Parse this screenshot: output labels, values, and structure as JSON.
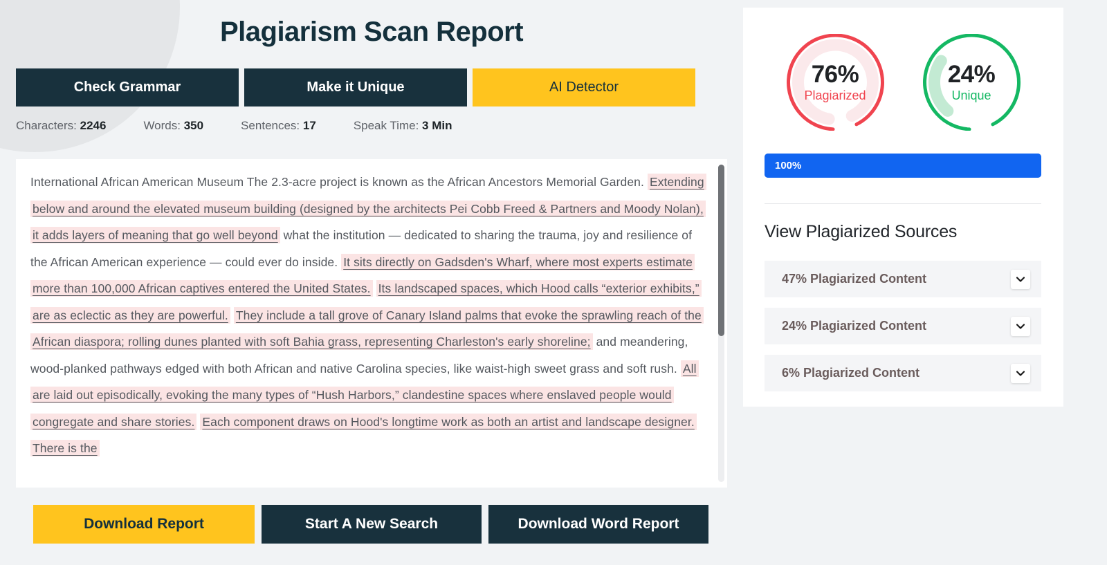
{
  "page": {
    "title": "Plagiarism Scan Report",
    "background_color": "#f1f3f5"
  },
  "tabs": [
    {
      "label": "Check Grammar",
      "style": "dark"
    },
    {
      "label": "Make it Unique",
      "style": "dark"
    },
    {
      "label": "AI Detector",
      "style": "accent"
    }
  ],
  "stats": [
    {
      "label": "Characters:",
      "value": "2246"
    },
    {
      "label": "Words:",
      "value": "350"
    },
    {
      "label": "Sentences:",
      "value": "17"
    },
    {
      "label": "Speak Time:",
      "value": "3 Min"
    }
  ],
  "document_text": {
    "segments": [
      {
        "text": "International African American Museum The 2.3-acre project is known as the African Ancestors Memorial Garden. ",
        "highlighted": false
      },
      {
        "text": "Extending below and around the elevated museum building (designed by the architects Pei Cobb Freed & Partners and Moody Nolan), it adds layers of meaning that go well beyond",
        "highlighted": true
      },
      {
        "text": " what the institution — dedicated to sharing the trauma, joy and resilience of the African American experience — could ever do inside. ",
        "highlighted": false
      },
      {
        "text": "It sits directly on Gadsden's Wharf, where most experts estimate more than 100,000 African captives entered the United States.",
        "highlighted": true
      },
      {
        "text": " ",
        "highlighted": false
      },
      {
        "text": "Its landscaped spaces, which Hood calls “exterior exhibits,” are as eclectic as they are powerful.",
        "highlighted": true
      },
      {
        "text": " ",
        "highlighted": false
      },
      {
        "text": "They include a tall grove of Canary Island palms that evoke the sprawling reach of the African diaspora; rolling dunes planted with soft Bahia grass, representing Charleston's early shoreline;",
        "highlighted": true
      },
      {
        "text": " and meandering, wood-planked pathways edged with both African and native Carolina species, like waist-high sweet grass and soft rush. ",
        "highlighted": false
      },
      {
        "text": "All are laid out episodically, evoking the many types of “Hush Harbors,” clandestine spaces where enslaved people would congregate and share stories.",
        "highlighted": true
      },
      {
        "text": " ",
        "highlighted": false
      },
      {
        "text": "Each component draws on Hood's longtime work as both an artist and landscape designer.",
        "highlighted": true
      },
      {
        "text": " ",
        "highlighted": false
      },
      {
        "text": "There is the",
        "highlighted": true
      }
    ]
  },
  "bottom_actions": [
    {
      "label": "Download Report",
      "style": "yellow"
    },
    {
      "label": "Start A New Search",
      "style": "dark"
    },
    {
      "label": "Download Word Report",
      "style": "dark"
    }
  ],
  "results_panel": {
    "gauges": [
      {
        "percent": "76%",
        "name": "Plagiarized",
        "value": 76,
        "color": "#f0444f",
        "track_color": "#fbe9eb"
      },
      {
        "percent": "24%",
        "name": "Unique",
        "value": 24,
        "color": "#14b863",
        "track_color": "#c3ead3"
      }
    ],
    "progress": {
      "label": "100%",
      "value": 100,
      "color": "#1165f1"
    },
    "sources_title": "View Plagiarized Sources",
    "sources": [
      {
        "label": "47% Plagiarized Content",
        "percent": 47
      },
      {
        "label": "24% Plagiarized Content",
        "percent": 24
      },
      {
        "label": "6% Plagiarized Content",
        "percent": 6
      }
    ]
  },
  "icons": {
    "chevron_down": "chevron-down-icon"
  }
}
